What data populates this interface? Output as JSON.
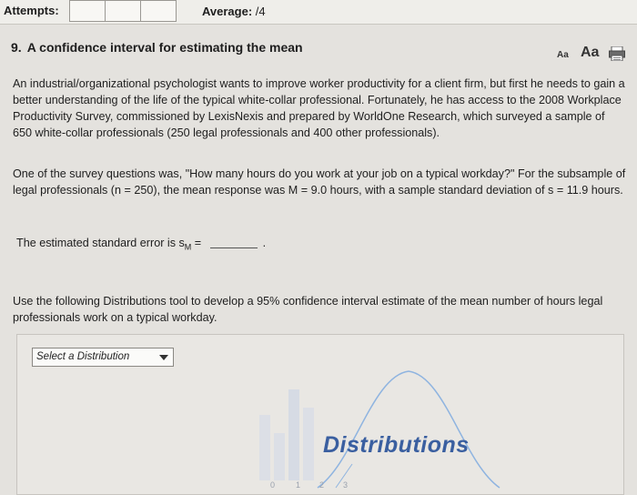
{
  "header": {
    "attempts_label": "Attempts:",
    "attempt_slots": 3,
    "average_label": "Average:",
    "average_value": "/4"
  },
  "question": {
    "number": "9.",
    "title": "A confidence interval for estimating the mean",
    "font_small": "Aa",
    "font_large": "Aa",
    "paragraph1": "An industrial/organizational psychologist wants to improve worker productivity for a client firm, but first he needs to gain a better understanding of the life of the typical white-collar professional. Fortunately, he has access to the 2008 Workplace Productivity Survey, commissioned by LexisNexis and prepared by WorldOne Research, which surveyed a sample of 650 white-collar professionals (250 legal professionals and 400 other professionals).",
    "paragraph2": "One of the survey questions was, \"How many hours do you work at your job on a typical workday?\" For the subsample of legal professionals (n = 250), the mean response was M = 9.0 hours, with a sample standard deviation of s = 11.9 hours.",
    "se_prompt": "The estimated standard error is s",
    "se_subscript": "M",
    "se_equals": " =",
    "se_period": ".",
    "paragraph3": "Use the following Distributions tool to develop a 95% confidence interval estimate of the mean number of hours legal professionals work on a typical workday."
  },
  "tool": {
    "select_placeholder": "Select a Distribution",
    "logo_text": "Distributions",
    "axis_ticks": [
      "0",
      "1",
      "2",
      "3"
    ]
  },
  "colors": {
    "curve": "#8fb4e0",
    "logo": "#3a5fa0"
  }
}
